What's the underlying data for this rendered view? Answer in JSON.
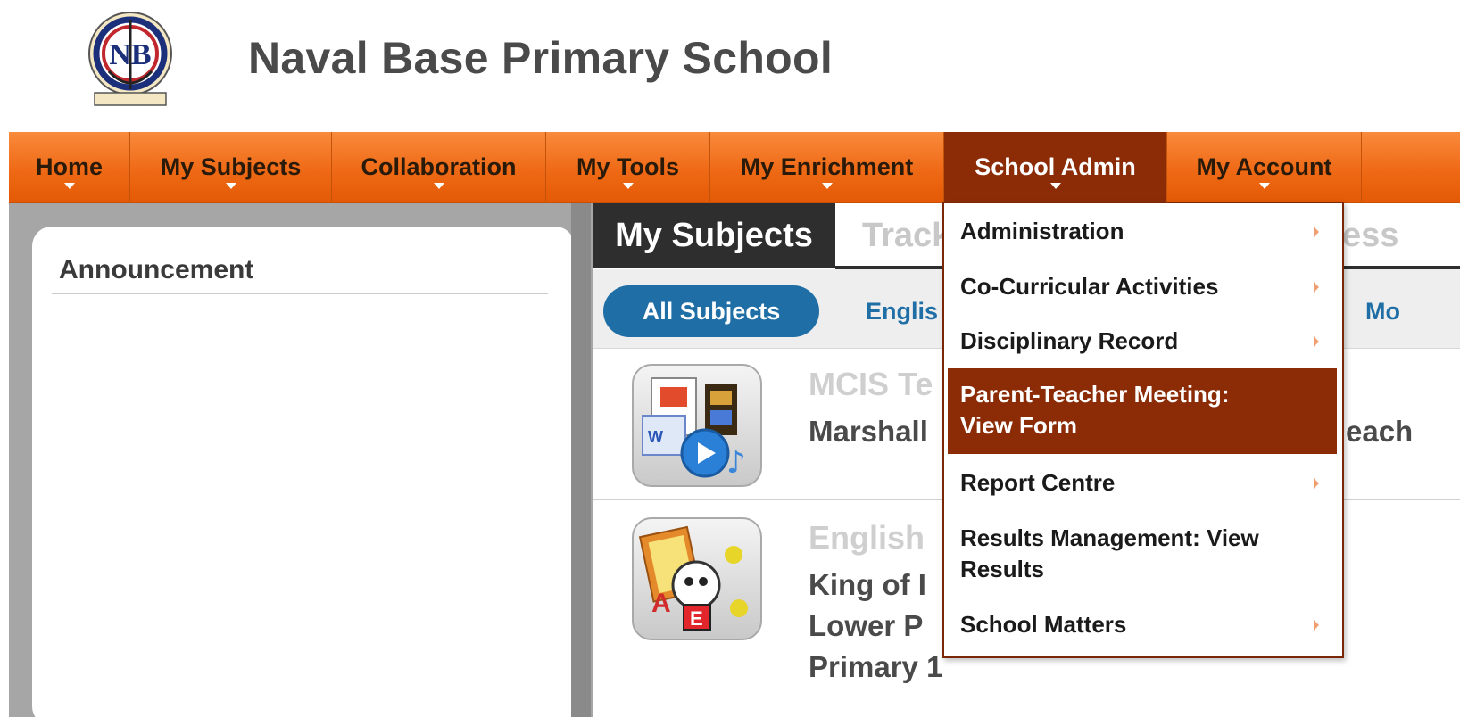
{
  "header": {
    "school_name": "Naval Base Primary School",
    "logo_text": "NB"
  },
  "nav": {
    "items": [
      {
        "label": "Home"
      },
      {
        "label": "My Subjects"
      },
      {
        "label": "Collaboration"
      },
      {
        "label": "My Tools"
      },
      {
        "label": "My Enrichment"
      },
      {
        "label": "School Admin",
        "active": true
      },
      {
        "label": "My Account"
      }
    ]
  },
  "sidebar": {
    "announcement_title": "Announcement"
  },
  "main": {
    "tabs": {
      "my_subjects": "My Subjects",
      "track_partial": "Track",
      "ess_partial": "ess"
    },
    "filters": {
      "all_subjects": "All Subjects",
      "english_partial": "Englis",
      "mo_partial": "Mo"
    },
    "subjects": [
      {
        "code": "MCIS Te",
        "name_line1": "Marshall",
        "name_tail": "each"
      },
      {
        "code": "English",
        "name_line1": "King of I",
        "name_line2": "Lower P",
        "name_line3": "Primary 1"
      }
    ]
  },
  "dropdown": {
    "items": [
      {
        "label": "Administration",
        "has_submenu": true
      },
      {
        "label": "Co-Curricular Activities",
        "has_submenu": true
      },
      {
        "label": "Disciplinary Record",
        "has_submenu": true
      },
      {
        "label_line1": "Parent-Teacher Meeting:",
        "label_line2": "View Form",
        "highlighted": true
      },
      {
        "label": "Report Centre",
        "has_submenu": true
      },
      {
        "label_line1": "Results Management: View",
        "label_line2": "Results"
      },
      {
        "label": "School Matters",
        "has_submenu": true
      }
    ]
  },
  "colors": {
    "nav_orange": "#ef6a16",
    "nav_active": "#8b2c07",
    "pill_blue": "#1f6fa6",
    "tab_dark": "#2e2e2e"
  }
}
